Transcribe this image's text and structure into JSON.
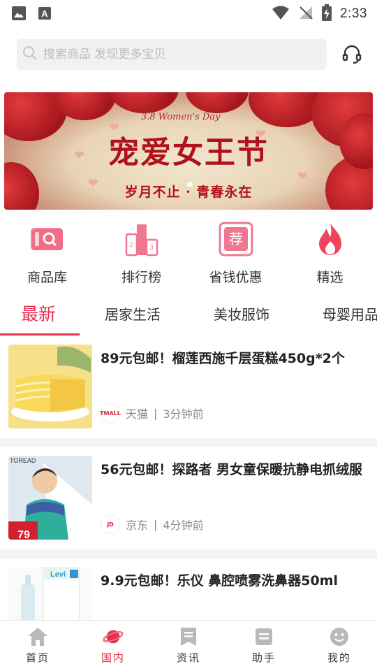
{
  "status_bar": {
    "time": "2:33"
  },
  "search": {
    "placeholder": "搜索商品 发现更多宝贝"
  },
  "banner": {
    "mini_text": "3.8 Women's Day",
    "title": "宠爱女王节",
    "subtitle": "岁月不止 · 青春永在"
  },
  "categories": [
    {
      "label": "商品库",
      "icon": "product-library-icon"
    },
    {
      "label": "排行榜",
      "icon": "ranking-icon"
    },
    {
      "label": "省钱优惠",
      "icon": "recommend-icon",
      "badge": "荐"
    },
    {
      "label": "精选",
      "icon": "flame-icon"
    }
  ],
  "tabs": [
    "最新",
    "居家生活",
    "美妆服饰",
    "母婴用品"
  ],
  "feed": [
    {
      "title": "89元包邮！榴莲西施千层蛋糕450g*2个",
      "shop": "天猫",
      "shop_logo": "TMALL",
      "time": "3分钟前"
    },
    {
      "title": "56元包邮！探路者 男女童保暖抗静电抓绒服",
      "shop": "京东",
      "shop_logo": "JD",
      "time": "4分钟前",
      "thumb_brand": "TOREAD",
      "thumb_price": "79"
    },
    {
      "title": "9.9元包邮！乐仪 鼻腔喷雾洗鼻器50ml",
      "thumb_brand": "Levi"
    }
  ],
  "meta_separator": "|",
  "bottom_nav": [
    {
      "label": "首页",
      "icon": "home-icon"
    },
    {
      "label": "国内",
      "icon": "planet-icon"
    },
    {
      "label": "资讯",
      "icon": "news-icon"
    },
    {
      "label": "助手",
      "icon": "assistant-icon"
    },
    {
      "label": "我的",
      "icon": "profile-icon"
    }
  ],
  "colors": {
    "accent": "#e8304f",
    "text": "#222222",
    "muted": "#8a8a8a"
  }
}
